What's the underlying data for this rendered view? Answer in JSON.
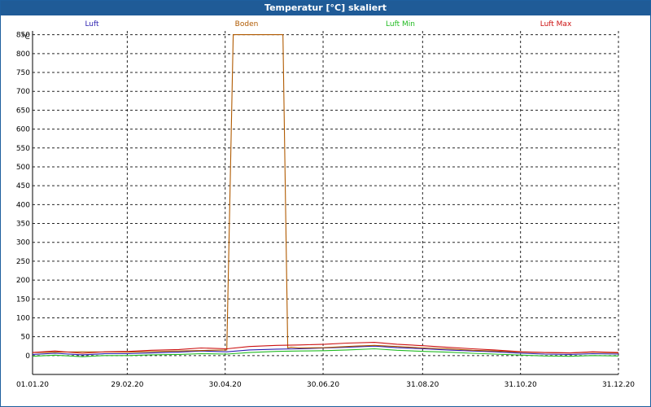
{
  "window": {
    "title": "Temperatur [°C] skaliert"
  },
  "chart_data": {
    "type": "line",
    "title": "Temperatur [°C] skaliert",
    "ylabel": "°C",
    "xlabel": "",
    "ylim": [
      -50,
      860
    ],
    "xlim": [
      "2020-01-01",
      "2020-12-31"
    ],
    "grid": true,
    "legend_position": "top",
    "y_ticks": [
      0,
      50,
      100,
      150,
      200,
      250,
      300,
      350,
      400,
      450,
      500,
      550,
      600,
      650,
      700,
      750,
      800,
      850
    ],
    "x_ticks": [
      {
        "date": "2020-01-01",
        "label": "01.01.20"
      },
      {
        "date": "2020-02-29",
        "label": "29.02.20"
      },
      {
        "date": "2020-04-30",
        "label": "30.04.20"
      },
      {
        "date": "2020-06-30",
        "label": "30.06.20"
      },
      {
        "date": "2020-08-31",
        "label": "31.08.20"
      },
      {
        "date": "2020-10-31",
        "label": "31.10.20"
      },
      {
        "date": "2020-12-31",
        "label": "31.12.20"
      }
    ],
    "series": [
      {
        "name": "Luft",
        "color": "#2b1fb0",
        "x": [
          "2020-01-01",
          "2020-01-15",
          "2020-02-01",
          "2020-02-15",
          "2020-03-01",
          "2020-03-15",
          "2020-04-01",
          "2020-04-15",
          "2020-05-01",
          "2020-05-15",
          "2020-06-01",
          "2020-06-15",
          "2020-07-01",
          "2020-07-15",
          "2020-08-01",
          "2020-08-15",
          "2020-09-01",
          "2020-09-15",
          "2020-10-01",
          "2020-10-15",
          "2020-11-01",
          "2020-11-15",
          "2020-12-01",
          "2020-12-15",
          "2020-12-31"
        ],
        "y": [
          3,
          6,
          2,
          5,
          5,
          7,
          9,
          12,
          10,
          15,
          17,
          18,
          20,
          22,
          25,
          21,
          18,
          15,
          12,
          10,
          6,
          4,
          3,
          5,
          4
        ]
      },
      {
        "name": "Boden",
        "color": "#b05a00",
        "x": [
          "2020-01-01",
          "2020-02-01",
          "2020-03-01",
          "2020-04-01",
          "2020-05-01",
          "2020-05-05",
          "2020-05-08",
          "2020-06-05",
          "2020-06-08",
          "2020-06-10",
          "2020-06-15",
          "2020-07-01",
          "2020-07-20",
          "2020-08-01",
          "2020-08-15",
          "2020-09-01",
          "2020-09-15",
          "2020-10-01",
          "2020-10-15",
          "2020-11-01",
          "2020-11-15",
          "2020-12-01",
          "2020-12-15",
          "2020-12-31"
        ],
        "y": [
          8,
          10,
          9,
          12,
          15,
          850,
          850,
          850,
          20,
          22,
          20,
          21,
          25,
          27,
          24,
          20,
          18,
          14,
          12,
          9,
          8,
          7,
          9,
          7
        ]
      },
      {
        "name": "Luft Min",
        "color": "#22bb22",
        "x": [
          "2020-01-01",
          "2020-01-15",
          "2020-02-01",
          "2020-02-15",
          "2020-03-01",
          "2020-03-15",
          "2020-04-01",
          "2020-04-15",
          "2020-05-01",
          "2020-05-15",
          "2020-06-01",
          "2020-06-15",
          "2020-07-01",
          "2020-07-15",
          "2020-08-01",
          "2020-08-15",
          "2020-09-01",
          "2020-09-15",
          "2020-10-01",
          "2020-10-15",
          "2020-11-01",
          "2020-11-15",
          "2020-12-01",
          "2020-12-15",
          "2020-12-31"
        ],
        "y": [
          -2,
          1,
          -3,
          0,
          0,
          2,
          3,
          5,
          4,
          8,
          11,
          12,
          13,
          15,
          18,
          14,
          11,
          9,
          6,
          4,
          1,
          -1,
          -2,
          0,
          -1
        ]
      },
      {
        "name": "Luft Max",
        "color": "#cc1111",
        "x": [
          "2020-01-01",
          "2020-01-15",
          "2020-02-01",
          "2020-02-15",
          "2020-03-01",
          "2020-03-15",
          "2020-04-01",
          "2020-04-15",
          "2020-05-01",
          "2020-05-15",
          "2020-06-01",
          "2020-06-15",
          "2020-07-01",
          "2020-07-15",
          "2020-08-01",
          "2020-08-15",
          "2020-09-01",
          "2020-09-15",
          "2020-10-01",
          "2020-10-15",
          "2020-11-01",
          "2020-11-15",
          "2020-12-01",
          "2020-12-15",
          "2020-12-31"
        ],
        "y": [
          8,
          12,
          6,
          10,
          11,
          14,
          16,
          20,
          18,
          24,
          27,
          28,
          30,
          33,
          35,
          30,
          26,
          22,
          18,
          15,
          10,
          8,
          7,
          10,
          8
        ]
      }
    ]
  }
}
